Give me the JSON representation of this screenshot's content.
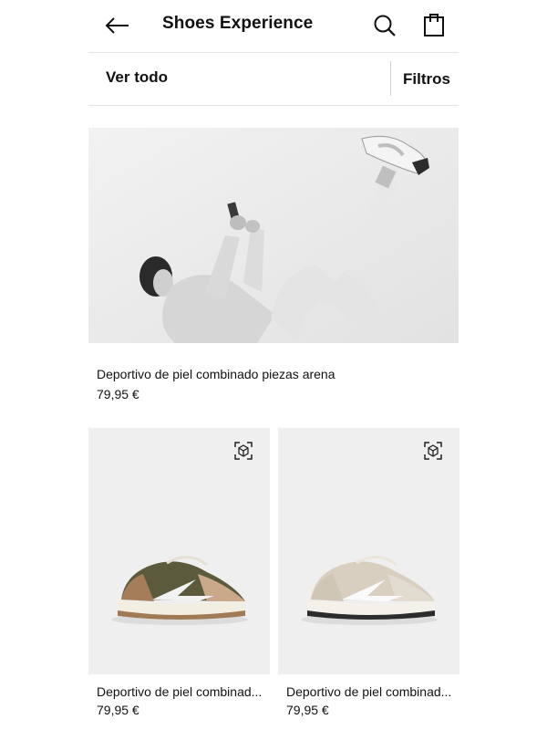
{
  "header": {
    "title": "Shoes Experience",
    "icons": [
      "arrow-left-icon",
      "search-icon",
      "shopping-bag-icon"
    ]
  },
  "filters": {
    "view_all": "Ver todo",
    "filters_label": "Filtros"
  },
  "hero_product": {
    "name": "Deportivo de piel combinado piezas arena",
    "price": "79,95 €"
  },
  "products": [
    {
      "name": "Deportivo de piel combinad...",
      "price": "79,95 €",
      "icon": "ar-cube-icon"
    },
    {
      "name": "Deportivo de piel combinad...",
      "price": "79,95 €",
      "icon": "ar-cube-icon"
    }
  ],
  "colors": {
    "text": "#111111",
    "divider": "#e3e3e3",
    "card_bg": "#eeeeee"
  }
}
